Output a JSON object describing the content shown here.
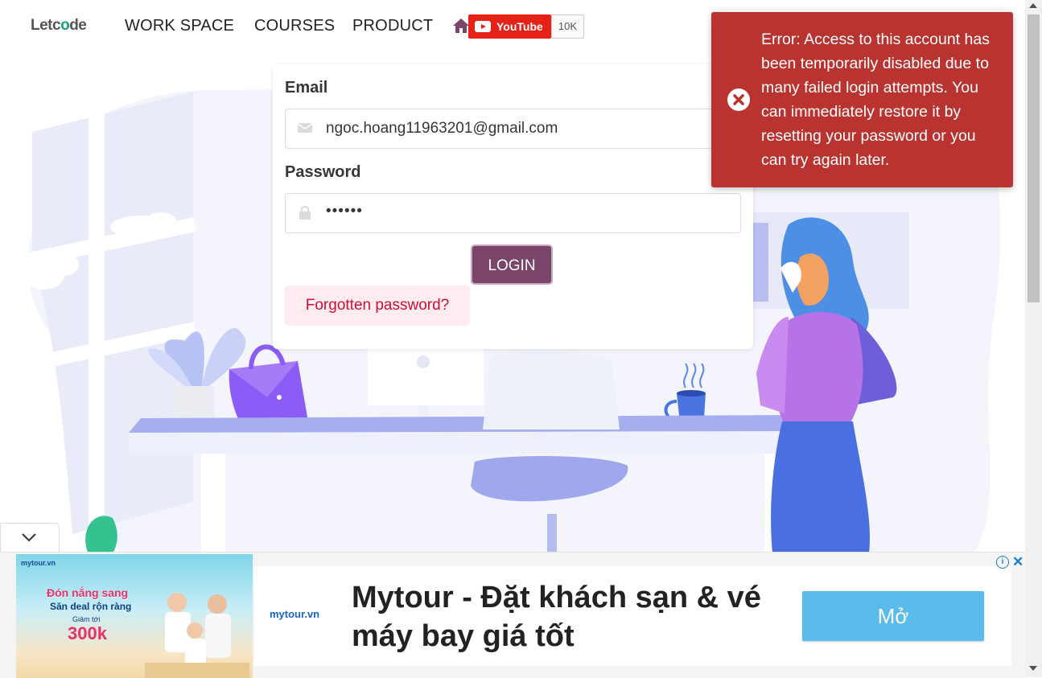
{
  "header": {
    "logo_text_a": "Letc",
    "logo_text_o": "o",
    "logo_text_b": "de",
    "nav": [
      "WORK SPACE",
      "COURSES",
      "PRODUCT"
    ],
    "youtube_label": "YouTube",
    "youtube_count": "10K"
  },
  "login": {
    "email_label": "Email",
    "email_value": "ngoc.hoang11963201@gmail.com",
    "password_label": "Password",
    "password_value": "••••••",
    "login_button": "LOGIN",
    "forgot_link": "Forgotten password?"
  },
  "toast": {
    "message": "Error: Access to this account has been temporarily disabled due to many failed login attempts. You can immediately restore it by resetting your password or you can try again later.",
    "color": "#b93330"
  },
  "ad": {
    "image_brand": "mytour.vn",
    "image_headline": "Đón nắng sang",
    "image_subline": "Săn deal rộn ràng",
    "image_small": "Giảm tới",
    "image_big": "300k",
    "logo": "mytour.vn",
    "title": "Mytour - Đặt khách sạn & vé máy bay giá tốt",
    "button": "Mở",
    "info": "i",
    "close": "✕"
  },
  "colors": {
    "accent": "#7a4568",
    "forgot_bg": "#feecf0",
    "forgot_text": "#cc0f35",
    "ad_button": "#5bbcec"
  }
}
